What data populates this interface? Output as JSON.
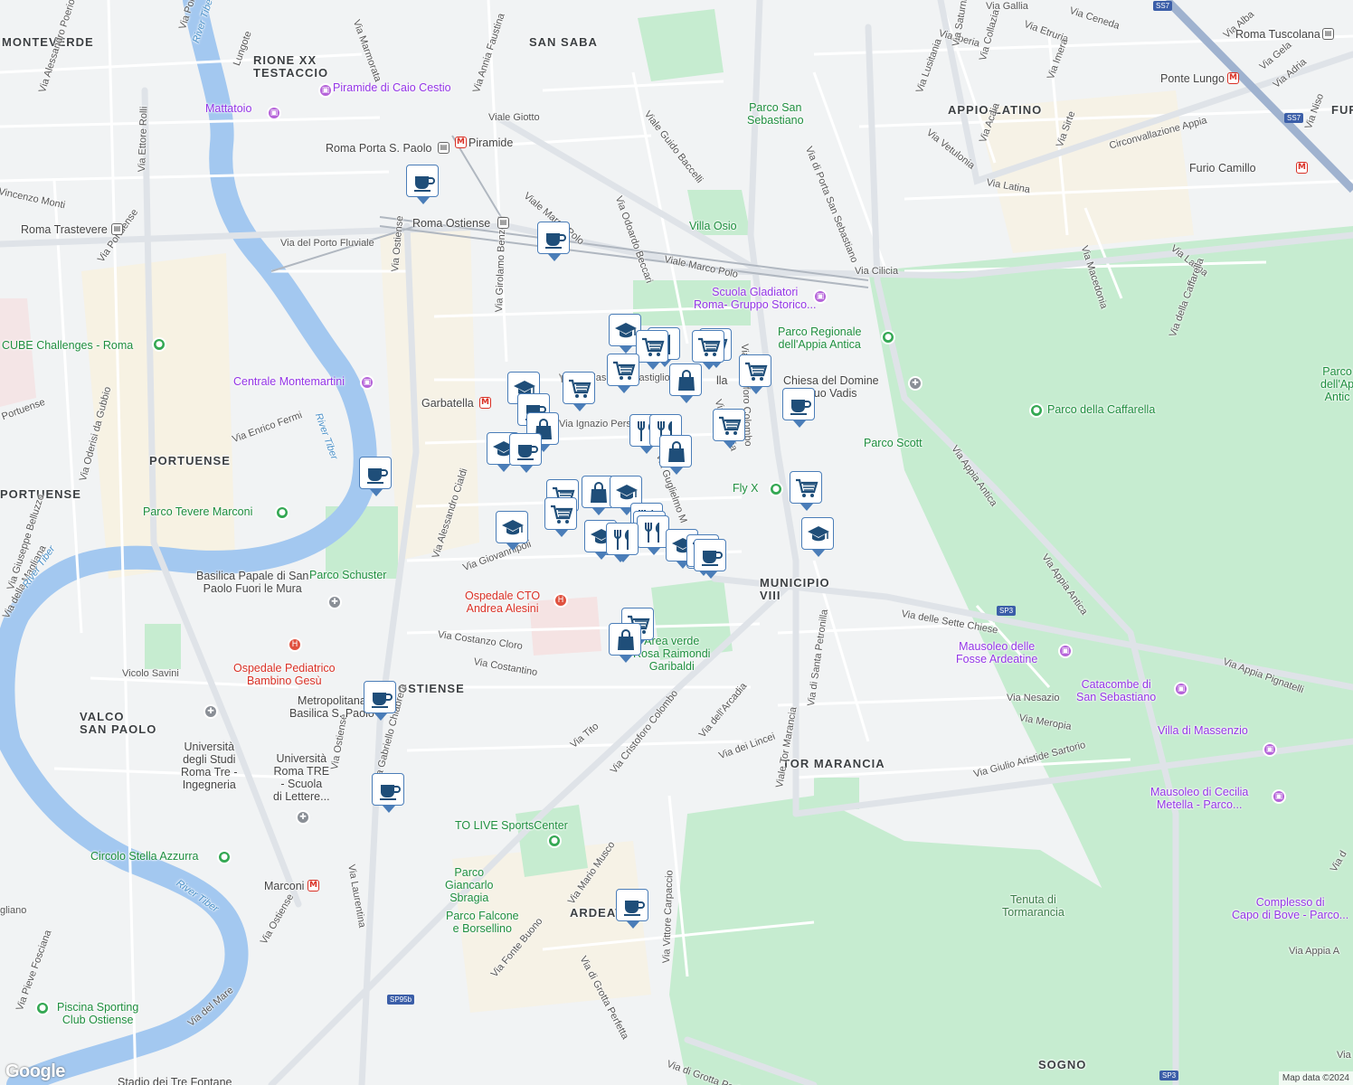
{
  "map": {
    "districts": [
      {
        "id": "monteverde",
        "text": "MONTEVERDE"
      },
      {
        "id": "testaccio",
        "text": "RIONE XX\nTESTACCIO"
      },
      {
        "id": "sansaba",
        "text": "SAN SABA"
      },
      {
        "id": "appio",
        "text": "APPIO-LATINO"
      },
      {
        "id": "portuense",
        "text": "PORTUENSE"
      },
      {
        "id": "portuense2",
        "text": "PORTUENSE"
      },
      {
        "id": "municipio",
        "text": "MUNICIPIO\nVIII"
      },
      {
        "id": "ostiense",
        "text": "OSTIENSE"
      },
      {
        "id": "valco",
        "text": "VALCO\nSAN PAOLO"
      },
      {
        "id": "tormarancia",
        "text": "TOR MARANCIA"
      },
      {
        "id": "ardea",
        "text": "ARDEAT"
      },
      {
        "id": "sogno",
        "text": "SOGNO"
      },
      {
        "id": "fur",
        "text": "FUR"
      }
    ],
    "streets": [
      {
        "id": "s1",
        "text": "Via Marmorata"
      },
      {
        "id": "s2",
        "text": "Via Porto"
      },
      {
        "id": "s3",
        "text": "Lungote"
      },
      {
        "id": "s4",
        "text": "Via Alessandro Poerio"
      },
      {
        "id": "s5",
        "text": "Via Annia Faustina"
      },
      {
        "id": "s6",
        "text": "Viale Giotto"
      },
      {
        "id": "s7",
        "text": "Viale Guido Baccelli"
      },
      {
        "id": "s8",
        "text": "Viale Marco Polo"
      },
      {
        "id": "s9",
        "text": "Viale Marco Polo"
      },
      {
        "id": "s10",
        "text": "Via Odoardo Beccari"
      },
      {
        "id": "s11",
        "text": "Via del Porto Fluviale"
      },
      {
        "id": "s12",
        "text": "Via Ettore Rolli"
      },
      {
        "id": "s13",
        "text": "Vincenzo Monti"
      },
      {
        "id": "s14",
        "text": "Via Portuense"
      },
      {
        "id": "s15",
        "text": "Via Ostiense"
      },
      {
        "id": "s16",
        "text": "Via Girolamo Benzoni"
      },
      {
        "id": "s17",
        "text": "Via Cilicia"
      },
      {
        "id": "s18",
        "text": "Via di Porta San Sebastiano"
      },
      {
        "id": "s19",
        "text": "Via Latina"
      },
      {
        "id": "s20",
        "text": "Via Latina"
      },
      {
        "id": "s21",
        "text": "Via Macedonia"
      },
      {
        "id": "s22",
        "text": "Via della Caffarella"
      },
      {
        "id": "s23",
        "text": "Circonvallazione Appia"
      },
      {
        "id": "s24",
        "text": "Via Sirte"
      },
      {
        "id": "s25",
        "text": "Via Acaia"
      },
      {
        "id": "s26",
        "text": "Via Vetulonia"
      },
      {
        "id": "s27",
        "text": "Via Lusitania"
      },
      {
        "id": "s28",
        "text": "Via Iberia"
      },
      {
        "id": "s29",
        "text": "Via Etruria"
      },
      {
        "id": "s30",
        "text": "Via Gallia"
      },
      {
        "id": "s31",
        "text": "Via Ceneda"
      },
      {
        "id": "s32",
        "text": "Via Alba"
      },
      {
        "id": "s33",
        "text": "Via Gela"
      },
      {
        "id": "s34",
        "text": "Via Adria"
      },
      {
        "id": "s35",
        "text": "Via Niso"
      },
      {
        "id": "s36",
        "text": "Via Imera"
      },
      {
        "id": "s37",
        "text": "Via Saturnia"
      },
      {
        "id": "s38",
        "text": "Via Collazia"
      },
      {
        "id": "s39",
        "text": "Via Oderisi da Gubbio"
      },
      {
        "id": "s40",
        "text": "Via Enrico Fermi"
      },
      {
        "id": "s41",
        "text": "Via Alessandro Cialdi"
      },
      {
        "id": "s42",
        "text": "Via Giovannipoli"
      },
      {
        "id": "s43",
        "text": "Via Costanzo Cloro"
      },
      {
        "id": "s44",
        "text": "Via Costantino"
      },
      {
        "id": "s45",
        "text": "Via Tito"
      },
      {
        "id": "s46",
        "text": "Via Cristoforo Colombo"
      },
      {
        "id": "s47",
        "text": "Viale Tor Marancia"
      },
      {
        "id": "s48",
        "text": "Via dell'Arcadia"
      },
      {
        "id": "s49",
        "text": "Via dei Lincei"
      },
      {
        "id": "s50",
        "text": "Via di Santa Petronilla"
      },
      {
        "id": "s51",
        "text": "Via delle Sette Chiese"
      },
      {
        "id": "s52",
        "text": "Via Appia Antica"
      },
      {
        "id": "s53",
        "text": "Via Appia Antica"
      },
      {
        "id": "s54",
        "text": "Via Appia Pignatelli"
      },
      {
        "id": "s55",
        "text": "Via Nesazio"
      },
      {
        "id": "s56",
        "text": "Via Meropia"
      },
      {
        "id": "s57",
        "text": "Via Giulio Aristide Sartorio"
      },
      {
        "id": "s58",
        "text": "Via Mario Musco"
      },
      {
        "id": "s59",
        "text": "Via Vittore Carpaccio"
      },
      {
        "id": "s60",
        "text": "Via di Grotta Perfetta"
      },
      {
        "id": "s61",
        "text": "Via di Grotta Perfe"
      },
      {
        "id": "s62",
        "text": "Via Fonte Buono"
      },
      {
        "id": "s63",
        "text": "Via Laurentina"
      },
      {
        "id": "s64",
        "text": "Via del Mare"
      },
      {
        "id": "s65",
        "text": "Via Ostiense"
      },
      {
        "id": "s66",
        "text": "Via Pieve Fosciana"
      },
      {
        "id": "s67",
        "text": "Via della Magliana"
      },
      {
        "id": "s68",
        "text": "Via Giuseppe Belluzzo"
      },
      {
        "id": "s69",
        "text": "Vicolo Savini"
      },
      {
        "id": "s70",
        "text": "Via Ostiense"
      },
      {
        "id": "s71",
        "text": "Via Gabriello Chiabrera"
      },
      {
        "id": "s72",
        "text": "Via Ignazio Persico"
      },
      {
        "id": "s73",
        "text": "Via Guglielmo M"
      },
      {
        "id": "s74",
        "text": "Via Cristoforo Colombo"
      },
      {
        "id": "s75",
        "text": "Via Armenia"
      },
      {
        "id": "s76",
        "text": "Portuense"
      },
      {
        "id": "s77",
        "text": "gliano"
      },
      {
        "id": "s78",
        "text": "Via d"
      },
      {
        "id": "s79",
        "text": "Via Appia A"
      },
      {
        "id": "s80",
        "text": "Via"
      }
    ],
    "places": [
      {
        "id": "p1",
        "text": "Piramide di Caio Cestio",
        "kind": "purple"
      },
      {
        "id": "p2",
        "text": "Mattatoio",
        "kind": "purple"
      },
      {
        "id": "p3",
        "text": "Piramide",
        "kind": "metro-label"
      },
      {
        "id": "p4",
        "text": "Roma Porta S. Paolo",
        "kind": "train-label"
      },
      {
        "id": "p5",
        "text": "Roma Ostiense",
        "kind": "train-label"
      },
      {
        "id": "p6",
        "text": "Roma Trastevere",
        "kind": "train-label"
      },
      {
        "id": "p7",
        "text": "Parco San\nSebastiano",
        "kind": "green"
      },
      {
        "id": "p8",
        "text": "Villa Osio",
        "kind": "green"
      },
      {
        "id": "p9",
        "text": "Scuola Gladiatori\nRoma- Gruppo Storico...",
        "kind": "purple"
      },
      {
        "id": "p10",
        "text": "Parco Regionale\ndell'Appia Antica",
        "kind": "green"
      },
      {
        "id": "p11",
        "text": "Chiesa del Domine\nQuo Vadis",
        "kind": "gray"
      },
      {
        "id": "p12",
        "text": "Parco della Caffarella",
        "kind": "green"
      },
      {
        "id": "p13",
        "text": "Parco Scott",
        "kind": "green"
      },
      {
        "id": "p14",
        "text": "Fly X",
        "kind": "green"
      },
      {
        "id": "p15",
        "text": "CUBE Challenges - Roma",
        "kind": "green"
      },
      {
        "id": "p16",
        "text": "Centrale Montemartini",
        "kind": "purple"
      },
      {
        "id": "p17",
        "text": "Garbatella",
        "kind": "metro-label"
      },
      {
        "id": "p18",
        "text": "Parco Tevere Marconi",
        "kind": "green"
      },
      {
        "id": "p19",
        "text": "Parco Schuster",
        "kind": "green"
      },
      {
        "id": "p20",
        "text": "Basilica Papale di San\nPaolo Fuori le Mura",
        "kind": "gray"
      },
      {
        "id": "p21",
        "text": "Ospedale CTO\nAndrea Alesini",
        "kind": "red"
      },
      {
        "id": "p22",
        "text": "Ospedale Pediatrico\nBambino Gesù",
        "kind": "red"
      },
      {
        "id": "p23",
        "text": "Area verde\nRosa Raimondi\nGaribaldi",
        "kind": "green"
      },
      {
        "id": "p24",
        "text": "Mausoleo delle\nFosse Ardeatine",
        "kind": "purple"
      },
      {
        "id": "p25",
        "text": "Catacombe di\nSan Sebastiano",
        "kind": "purple"
      },
      {
        "id": "p26",
        "text": "Villa di Massenzio",
        "kind": "purple"
      },
      {
        "id": "p27",
        "text": "Mausoleo di Cecilia\nMetella - Parco...",
        "kind": "purple"
      },
      {
        "id": "p28",
        "text": "Complesso di\nCapo di Bove - Parco...",
        "kind": "purple"
      },
      {
        "id": "p29",
        "text": "Tenuta di\nTormarancia",
        "kind": "green-plain"
      },
      {
        "id": "p30",
        "text": "Metropolitana\nBasilica S. Paolo",
        "kind": "metro-label"
      },
      {
        "id": "p31",
        "text": "Università\ndegli Studi\nRoma Tre -\nIngegneria",
        "kind": "gray"
      },
      {
        "id": "p32",
        "text": "Università\nRoma TRE\n- Scuola\ndi Lettere...",
        "kind": "gray"
      },
      {
        "id": "p33",
        "text": "TO LIVE SportsCenter",
        "kind": "green"
      },
      {
        "id": "p34",
        "text": "Parco\nGiancarlo\nSbragia",
        "kind": "green"
      },
      {
        "id": "p35",
        "text": "Parco Falcone\ne Borsellino",
        "kind": "green"
      },
      {
        "id": "p36",
        "text": "Circolo Stella Azzurra",
        "kind": "green"
      },
      {
        "id": "p37",
        "text": "Marconi",
        "kind": "metro-label"
      },
      {
        "id": "p38",
        "text": "Piscina Sporting\nClub Ostiense",
        "kind": "green"
      },
      {
        "id": "p39",
        "text": "Stadio dei Tre Fontane",
        "kind": "gray"
      },
      {
        "id": "p40",
        "text": "Roma Tuscolana",
        "kind": "train-label"
      },
      {
        "id": "p41",
        "text": "Ponte Lungo",
        "kind": "metro-label"
      },
      {
        "id": "p42",
        "text": "Furio Camillo",
        "kind": "metro-label"
      },
      {
        "id": "p43",
        "text": "Parco\ndell'Ap\nAntic",
        "kind": "green"
      },
      {
        "id": "p44",
        "text": "lla",
        "kind": "gray"
      },
      {
        "id": "p45",
        "text": "Via Baldassarre Castiglione",
        "kind": "street"
      },
      {
        "id": "p46",
        "text": "lcone",
        "kind": "street"
      }
    ],
    "rivers": [
      {
        "id": "r1",
        "text": "River Tiber"
      },
      {
        "id": "r2",
        "text": "River Tiber"
      },
      {
        "id": "r3",
        "text": "River Tiber"
      },
      {
        "id": "r4",
        "text": "River Tiber"
      }
    ],
    "shields": [
      {
        "id": "sh1",
        "text": "SS7"
      },
      {
        "id": "sh2",
        "text": "SS7"
      },
      {
        "id": "sh3",
        "text": "SP3"
      },
      {
        "id": "sh4",
        "text": "SP3"
      },
      {
        "id": "sh5",
        "text": "SP95b"
      }
    ],
    "markers": [
      {
        "id": "m1",
        "icon": "coffee"
      },
      {
        "id": "m2",
        "icon": "coffee"
      },
      {
        "id": "m3",
        "icon": "education"
      },
      {
        "id": "m4",
        "icon": "cart"
      },
      {
        "id": "m5",
        "icon": "restaurant"
      },
      {
        "id": "m6",
        "icon": "cart"
      },
      {
        "id": "m7",
        "icon": "cart"
      },
      {
        "id": "m8",
        "icon": "cart"
      },
      {
        "id": "m9",
        "icon": "bag"
      },
      {
        "id": "m10",
        "icon": "cart"
      },
      {
        "id": "m11",
        "icon": "cart"
      },
      {
        "id": "m12",
        "icon": "education"
      },
      {
        "id": "m13",
        "icon": "coffee"
      },
      {
        "id": "m14",
        "icon": "bag"
      },
      {
        "id": "m15",
        "icon": "coffee"
      },
      {
        "id": "m16",
        "icon": "restaurant"
      },
      {
        "id": "m17",
        "icon": "cart"
      },
      {
        "id": "m18",
        "icon": "restaurant"
      },
      {
        "id": "m19",
        "icon": "bag"
      },
      {
        "id": "m20",
        "icon": "education"
      },
      {
        "id": "m21",
        "icon": "coffee"
      },
      {
        "id": "m22",
        "icon": "coffee"
      },
      {
        "id": "m23",
        "icon": "cart"
      },
      {
        "id": "m24",
        "icon": "bag"
      },
      {
        "id": "m25",
        "icon": "education"
      },
      {
        "id": "m26",
        "icon": "cart"
      },
      {
        "id": "m27",
        "icon": "cart"
      },
      {
        "id": "m28",
        "icon": "education"
      },
      {
        "id": "m29",
        "icon": "education"
      },
      {
        "id": "m30",
        "icon": "restaurant"
      },
      {
        "id": "m31",
        "icon": "restaurant"
      },
      {
        "id": "m32",
        "icon": "restaurant"
      },
      {
        "id": "m33",
        "icon": "restaurant"
      },
      {
        "id": "m34",
        "icon": "education"
      },
      {
        "id": "m35",
        "icon": "restaurant"
      },
      {
        "id": "m36",
        "icon": "restaurant"
      },
      {
        "id": "m37",
        "icon": "cart"
      },
      {
        "id": "m38",
        "icon": "education"
      },
      {
        "id": "m39",
        "icon": "cart"
      },
      {
        "id": "m40",
        "icon": "bag"
      },
      {
        "id": "m41",
        "icon": "coffee"
      },
      {
        "id": "m42",
        "icon": "coffee"
      },
      {
        "id": "m43",
        "icon": "coffee"
      },
      {
        "id": "m44",
        "icon": "coffee"
      }
    ],
    "colors": {
      "water": "#a3c8f0",
      "park": "#c6ecd0",
      "road": "#ffffff",
      "major_road": "#dfe3e8",
      "highway": "#9fb2cf",
      "marker_border": "#4a7db8",
      "marker_icon": "#1f4e79"
    },
    "branding": {
      "logo": "Google",
      "copyright": "Map data ©2024"
    }
  }
}
